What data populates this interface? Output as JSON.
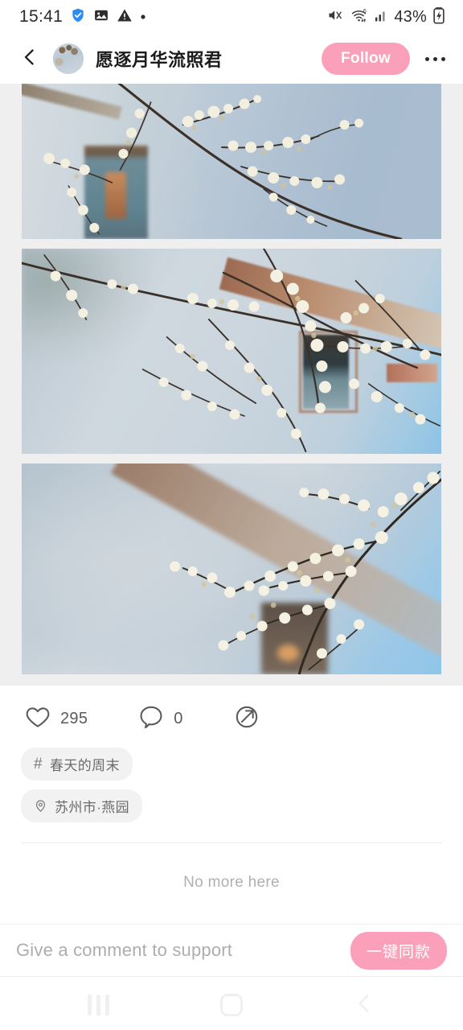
{
  "status_bar": {
    "time": "15:41",
    "battery_percent": "43%",
    "left_icons": [
      "shield-check-icon",
      "photo-icon",
      "warning-triangle-icon",
      "dot-icon"
    ],
    "right_icons": [
      "mute-icon",
      "wifi-6-icon",
      "signal-bars-icon",
      "battery-charging-icon"
    ]
  },
  "header": {
    "back_icon": "chevron-left-icon",
    "avatar": "user-avatar",
    "username": "愿逐月华流照君",
    "follow_label": "Follow",
    "more_icon": "more-horizontal-icon"
  },
  "post": {
    "photos": [
      {
        "alt": "plum-blossom-branch-against-wall"
      },
      {
        "alt": "plum-blossoms-over-white-wall-window"
      },
      {
        "alt": "plum-blossom-branch-blue-sky"
      }
    ]
  },
  "actions": {
    "like": {
      "icon": "heart-icon",
      "count": "295"
    },
    "comment": {
      "icon": "comment-bubble-icon",
      "count": "0"
    },
    "share": {
      "icon": "share-arrow-icon"
    }
  },
  "tags": [
    {
      "icon": "hash-icon",
      "label": "春天的周末"
    },
    {
      "icon": "location-pin-icon",
      "label": "苏州市·燕园"
    }
  ],
  "footer": {
    "no_more_label": "No more here"
  },
  "comment_bar": {
    "placeholder": "Give a comment to support",
    "value": "",
    "sync_label": "一键同款"
  },
  "nav_bar": {
    "recents": "recents-icon",
    "home": "home-icon",
    "back": "back-icon"
  },
  "colors": {
    "accent_pink": "#fba0bb",
    "page_bg": "#efefef",
    "text_primary": "#1b1b1b",
    "text_muted": "#b0b0b0"
  }
}
